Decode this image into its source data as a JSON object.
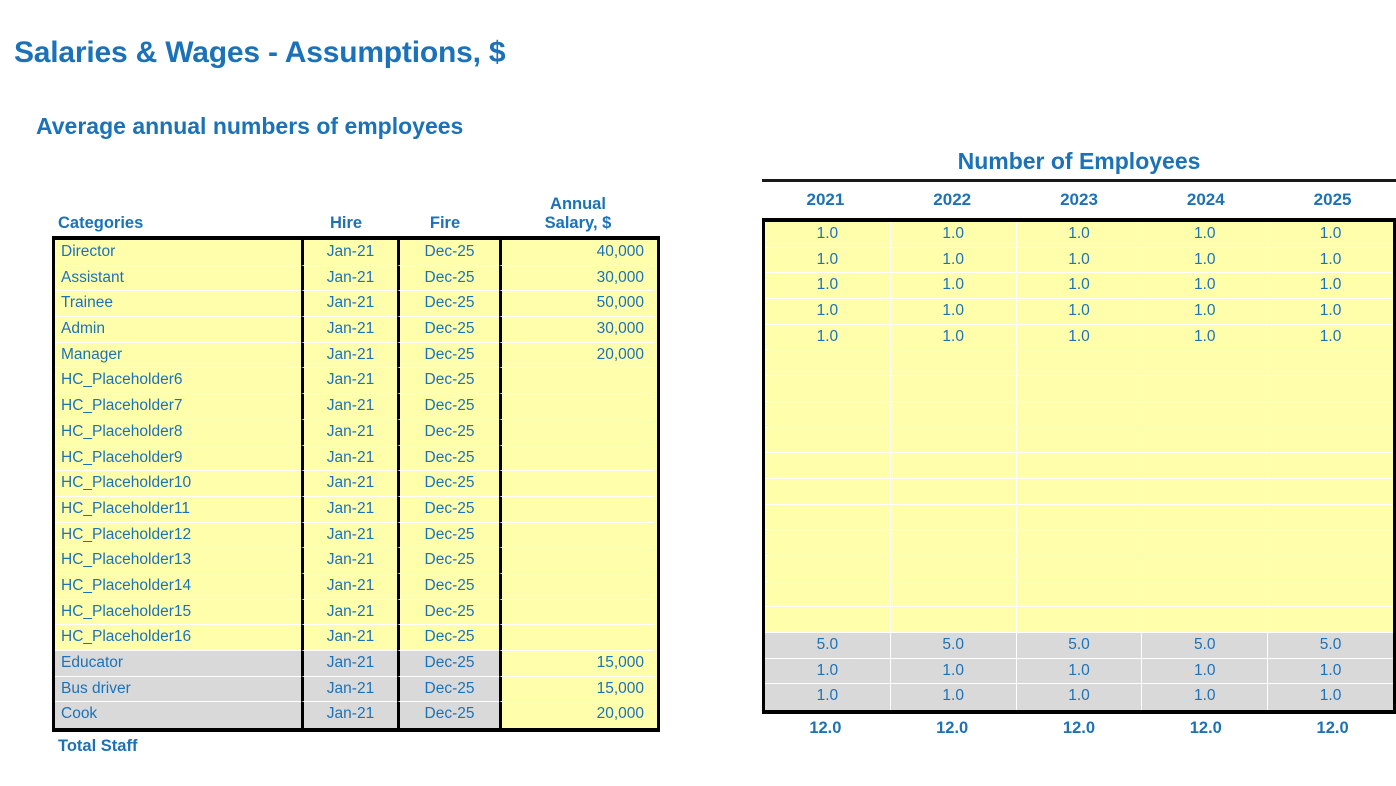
{
  "page": {
    "title": "Salaries & Wages - Assumptions, $",
    "subtitle": "Average annual numbers of employees",
    "accent_color": "#1C72B8",
    "fill_yellow": "#FFFFAB",
    "fill_grey": "#D9D9D9",
    "border_color": "#000000"
  },
  "left_table": {
    "headers": {
      "categories": "Categories",
      "hire": "Hire",
      "fire": "Fire",
      "annual_salary_line1": "Annual",
      "annual_salary_line2": "Salary, $"
    },
    "total_label": "Total Staff",
    "rows": [
      {
        "category": "Director",
        "hire": "Jan-21",
        "fire": "Dec-25",
        "salary": "40,000",
        "highlight": "yellow"
      },
      {
        "category": "Assistant",
        "hire": "Jan-21",
        "fire": "Dec-25",
        "salary": "30,000",
        "highlight": "yellow"
      },
      {
        "category": "Trainee",
        "hire": "Jan-21",
        "fire": "Dec-25",
        "salary": "50,000",
        "highlight": "yellow"
      },
      {
        "category": "Admin",
        "hire": "Jan-21",
        "fire": "Dec-25",
        "salary": "30,000",
        "highlight": "yellow"
      },
      {
        "category": "Manager",
        "hire": "Jan-21",
        "fire": "Dec-25",
        "salary": "20,000",
        "highlight": "yellow"
      },
      {
        "category": "HC_Placeholder6",
        "hire": "Jan-21",
        "fire": "Dec-25",
        "salary": "",
        "highlight": "yellow"
      },
      {
        "category": "HC_Placeholder7",
        "hire": "Jan-21",
        "fire": "Dec-25",
        "salary": "",
        "highlight": "yellow"
      },
      {
        "category": "HC_Placeholder8",
        "hire": "Jan-21",
        "fire": "Dec-25",
        "salary": "",
        "highlight": "yellow"
      },
      {
        "category": "HC_Placeholder9",
        "hire": "Jan-21",
        "fire": "Dec-25",
        "salary": "",
        "highlight": "yellow"
      },
      {
        "category": "HC_Placeholder10",
        "hire": "Jan-21",
        "fire": "Dec-25",
        "salary": "",
        "highlight": "yellow"
      },
      {
        "category": "HC_Placeholder11",
        "hire": "Jan-21",
        "fire": "Dec-25",
        "salary": "",
        "highlight": "yellow"
      },
      {
        "category": "HC_Placeholder12",
        "hire": "Jan-21",
        "fire": "Dec-25",
        "salary": "",
        "highlight": "yellow"
      },
      {
        "category": "HC_Placeholder13",
        "hire": "Jan-21",
        "fire": "Dec-25",
        "salary": "",
        "highlight": "yellow"
      },
      {
        "category": "HC_Placeholder14",
        "hire": "Jan-21",
        "fire": "Dec-25",
        "salary": "",
        "highlight": "yellow"
      },
      {
        "category": "HC_Placeholder15",
        "hire": "Jan-21",
        "fire": "Dec-25",
        "salary": "",
        "highlight": "yellow"
      },
      {
        "category": "HC_Placeholder16",
        "hire": "Jan-21",
        "fire": "Dec-25",
        "salary": "",
        "highlight": "yellow"
      },
      {
        "category": "Educator",
        "hire": "Jan-21",
        "fire": "Dec-25",
        "salary": "15,000",
        "highlight": "grey"
      },
      {
        "category": "Bus driver",
        "hire": "Jan-21",
        "fire": "Dec-25",
        "salary": "15,000",
        "highlight": "grey"
      },
      {
        "category": "Cook",
        "hire": "Jan-21",
        "fire": "Dec-25",
        "salary": "20,000",
        "highlight": "grey"
      }
    ]
  },
  "right_table": {
    "title": "Number of Employees",
    "years": [
      "2021",
      "2022",
      "2023",
      "2024",
      "2025"
    ],
    "rows": [
      {
        "values": [
          "1.0",
          "1.0",
          "1.0",
          "1.0",
          "1.0"
        ],
        "highlight": "yellow"
      },
      {
        "values": [
          "1.0",
          "1.0",
          "1.0",
          "1.0",
          "1.0"
        ],
        "highlight": "yellow"
      },
      {
        "values": [
          "1.0",
          "1.0",
          "1.0",
          "1.0",
          "1.0"
        ],
        "highlight": "yellow"
      },
      {
        "values": [
          "1.0",
          "1.0",
          "1.0",
          "1.0",
          "1.0"
        ],
        "highlight": "yellow"
      },
      {
        "values": [
          "1.0",
          "1.0",
          "1.0",
          "1.0",
          "1.0"
        ],
        "highlight": "yellow"
      },
      {
        "values": [
          "",
          "",
          "",
          "",
          ""
        ],
        "highlight": "yellow"
      },
      {
        "values": [
          "",
          "",
          "",
          "",
          ""
        ],
        "highlight": "yellow"
      },
      {
        "values": [
          "",
          "",
          "",
          "",
          ""
        ],
        "highlight": "yellow"
      },
      {
        "values": [
          "",
          "",
          "",
          "",
          ""
        ],
        "highlight": "yellow"
      },
      {
        "values": [
          "",
          "",
          "",
          "",
          ""
        ],
        "highlight": "yellow"
      },
      {
        "values": [
          "",
          "",
          "",
          "",
          ""
        ],
        "highlight": "yellow"
      },
      {
        "values": [
          "",
          "",
          "",
          "",
          ""
        ],
        "highlight": "yellow"
      },
      {
        "values": [
          "",
          "",
          "",
          "",
          ""
        ],
        "highlight": "yellow"
      },
      {
        "values": [
          "",
          "",
          "",
          "",
          ""
        ],
        "highlight": "yellow"
      },
      {
        "values": [
          "",
          "",
          "",
          "",
          ""
        ],
        "highlight": "yellow"
      },
      {
        "values": [
          "",
          "",
          "",
          "",
          ""
        ],
        "highlight": "yellow"
      },
      {
        "values": [
          "5.0",
          "5.0",
          "5.0",
          "5.0",
          "5.0"
        ],
        "highlight": "grey"
      },
      {
        "values": [
          "1.0",
          "1.0",
          "1.0",
          "1.0",
          "1.0"
        ],
        "highlight": "grey"
      },
      {
        "values": [
          "1.0",
          "1.0",
          "1.0",
          "1.0",
          "1.0"
        ],
        "highlight": "grey"
      }
    ],
    "totals": [
      "12.0",
      "12.0",
      "12.0",
      "12.0",
      "12.0"
    ]
  }
}
